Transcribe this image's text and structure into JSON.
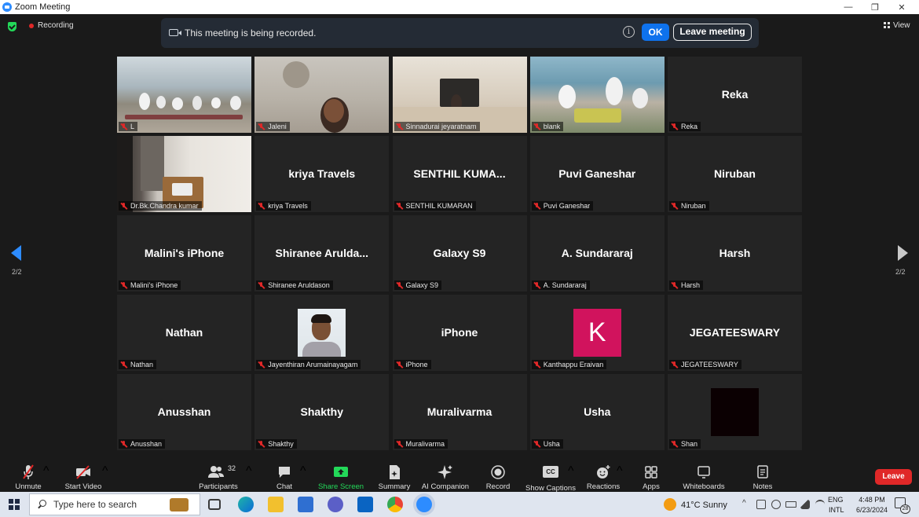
{
  "window": {
    "title": "Zoom Meeting",
    "minimize": "—",
    "restore": "❐",
    "close": "✕"
  },
  "status": {
    "recording": "Recording"
  },
  "banner": {
    "message": "This meeting is being recorded.",
    "info": "i",
    "ok": "OK",
    "leave": "Leave meeting"
  },
  "view_label": "View",
  "pagination": {
    "left": "2/2",
    "right": "2/2"
  },
  "tiles": [
    {
      "label": "L",
      "video": "yoga"
    },
    {
      "label": "Jaleni",
      "video": "jaleni"
    },
    {
      "label": "Sinnadurai jeyaratnam",
      "video": "sinna"
    },
    {
      "label": "blank",
      "video": "blank"
    },
    {
      "label": "Reka",
      "display": "Reka"
    },
    {
      "label": "Dr.Bk.Chandra kumar",
      "video": "chandra"
    },
    {
      "label": "kriya Travels",
      "display": "kriya Travels"
    },
    {
      "label": "SENTHIL KUMARAN",
      "display": "SENTHIL  KUMA..."
    },
    {
      "label": "Puvi Ganeshar",
      "display": "Puvi Ganeshar"
    },
    {
      "label": "Niruban",
      "display": "Niruban"
    },
    {
      "label": "Malini's iPhone",
      "display": "Malini's iPhone"
    },
    {
      "label": "Shiranee Aruldason",
      "display": "Shiranee  Arulda..."
    },
    {
      "label": "Galaxy S9",
      "display": "Galaxy S9"
    },
    {
      "label": "A. Sundararaj",
      "display": "A. Sundararaj"
    },
    {
      "label": "Harsh",
      "display": "Harsh"
    },
    {
      "label": "Nathan",
      "display": "Nathan"
    },
    {
      "label": "Jayenthiran Arumainayagam",
      "avatar": "photo"
    },
    {
      "label": "iPhone",
      "display": "iPhone"
    },
    {
      "label": "Kanthappu Eraivan",
      "avatar": "K"
    },
    {
      "label": "JEGATEESWARY",
      "display": "JEGATEESWARY"
    },
    {
      "label": "Anusshan",
      "display": "Anusshan"
    },
    {
      "label": "Shakthy",
      "display": "Shakthy"
    },
    {
      "label": "Muralivarma",
      "display": "Muralivarma"
    },
    {
      "label": "Usha",
      "display": "Usha"
    },
    {
      "label": "Shan",
      "avatar": "black"
    }
  ],
  "toolbar": {
    "unmute": "Unmute",
    "start_video": "Start Video",
    "participants": "Participants",
    "participants_count": "32",
    "chat": "Chat",
    "share_screen": "Share Screen",
    "summary": "Summary",
    "ai_companion": "AI Companion",
    "record": "Record",
    "show_captions": "Show Captions",
    "cc": "CC",
    "reactions": "Reactions",
    "apps": "Apps",
    "whiteboards": "Whiteboards",
    "notes": "Notes",
    "leave": "Leave",
    "caret": "^"
  },
  "taskbar": {
    "search_placeholder": "Type here to search",
    "weather": "41°C  Sunny",
    "lang_top": "ENG",
    "lang_bottom": "INTL",
    "time": "4:48 PM",
    "date": "6/23/2024",
    "notifications": "28"
  },
  "colors": {
    "accent": "#2d8cff",
    "ok_button": "#0e72ed",
    "leave_red": "#e02828",
    "mute_red": "#e02828",
    "share_green": "#23d959",
    "k_avatar": "#d1135d"
  }
}
